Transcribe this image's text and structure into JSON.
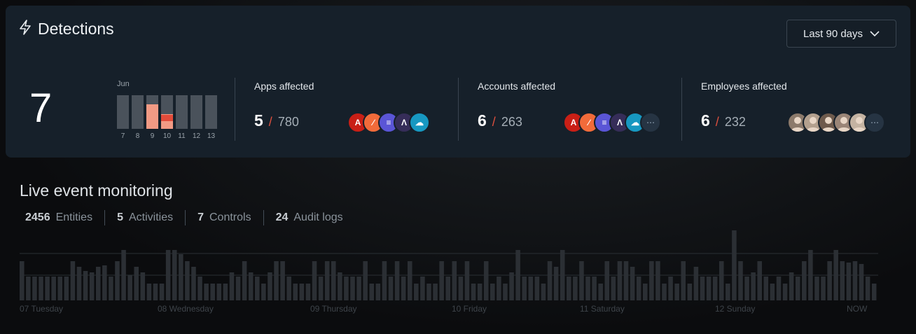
{
  "header": {
    "title": "Detections",
    "range_label": "Last 90 days"
  },
  "summary": {
    "total": "7",
    "mini_chart": {
      "month": "Jun",
      "days": [
        "7",
        "8",
        "9",
        "10",
        "11",
        "12",
        "13"
      ],
      "highlight": [
        0,
        0,
        0.72,
        0.44,
        0,
        0,
        0
      ],
      "highlight_dark": [
        0,
        0,
        0,
        0.24,
        0,
        0,
        0
      ]
    }
  },
  "stats": [
    {
      "label": "Apps affected",
      "n": "5",
      "total": "780",
      "icons": [
        "adobe-icon",
        "postman-icon",
        "evernote-icon",
        "sentry-icon",
        "salesforce-icon"
      ],
      "more": false
    },
    {
      "label": "Accounts affected",
      "n": "6",
      "total": "263",
      "icons": [
        "adobe-icon",
        "postman-icon",
        "evernote-icon",
        "sentry-icon",
        "salesforce-icon"
      ],
      "more": true
    },
    {
      "label": "Employees affected",
      "n": "6",
      "total": "232",
      "icons": [
        "avatar",
        "avatar",
        "avatar",
        "avatar",
        "avatar"
      ],
      "more": true
    }
  ],
  "live": {
    "title": "Live event monitoring",
    "counters": [
      {
        "value": "2456",
        "label": "Entities"
      },
      {
        "value": "5",
        "label": "Activities"
      },
      {
        "value": "7",
        "label": "Controls"
      },
      {
        "value": "24",
        "label": "Audit logs"
      }
    ],
    "x_labels": [
      "07 Tuesday",
      "08 Wednesday",
      "09 Thursday",
      "10 Friday",
      "11 Saturday",
      "12 Sunday",
      "NOW"
    ],
    "values": [
      56,
      34,
      34,
      34,
      34,
      34,
      34,
      34,
      56,
      48,
      42,
      40,
      48,
      50,
      34,
      56,
      72,
      36,
      48,
      40,
      24,
      24,
      24,
      72,
      72,
      66,
      56,
      48,
      34,
      24,
      24,
      24,
      24,
      40,
      34,
      56,
      40,
      34,
      24,
      40,
      56,
      56,
      34,
      24,
      24,
      24,
      56,
      34,
      56,
      56,
      40,
      34,
      34,
      34,
      56,
      24,
      24,
      56,
      34,
      56,
      34,
      56,
      24,
      34,
      24,
      24,
      56,
      34,
      56,
      34,
      56,
      24,
      24,
      56,
      24,
      34,
      24,
      40,
      72,
      34,
      34,
      34,
      24,
      56,
      48,
      72,
      34,
      34,
      56,
      34,
      34,
      24,
      56,
      34,
      56,
      56,
      48,
      34,
      24,
      56,
      56,
      24,
      34,
      24,
      56,
      24,
      48,
      34,
      34,
      34,
      56,
      24,
      100,
      56,
      34,
      40,
      56,
      34,
      24,
      34,
      24,
      40,
      34,
      56,
      72,
      34,
      34,
      56,
      72,
      56,
      54,
      56,
      52,
      34,
      24
    ]
  },
  "colors": {
    "accent": "#e0503e",
    "highlight_light": "#f29a84",
    "highlight_dark": "#e24b3a",
    "bar": "#2b2f34"
  }
}
